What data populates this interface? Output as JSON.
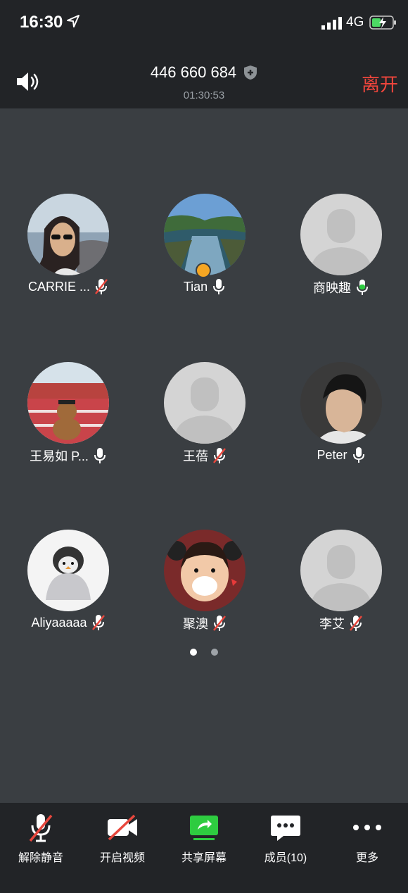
{
  "status_bar": {
    "time": "16:30",
    "network": "4G"
  },
  "header": {
    "meeting_id": "446 660 684",
    "timer": "01:30:53",
    "leave_label": "离开"
  },
  "participants": [
    {
      "name": "CARRIE ...",
      "mic": "muted",
      "avatar": "photo"
    },
    {
      "name": "Tian",
      "mic": "on",
      "avatar": "photo",
      "host": true
    },
    {
      "name": "商映趣",
      "mic": "speaking",
      "avatar": "placeholder"
    },
    {
      "name": "王易如 P...",
      "mic": "on",
      "avatar": "photo"
    },
    {
      "name": "王蓓",
      "mic": "muted",
      "avatar": "placeholder"
    },
    {
      "name": "Peter",
      "mic": "on",
      "avatar": "photo"
    },
    {
      "name": "Aliyaaaaa",
      "mic": "muted",
      "avatar": "photo"
    },
    {
      "name": "聚澳",
      "mic": "muted",
      "avatar": "photo"
    },
    {
      "name": "李艾",
      "mic": "muted",
      "avatar": "placeholder"
    }
  ],
  "pagination": {
    "current": 1,
    "total": 2
  },
  "toolbar": {
    "unmute_label": "解除静音",
    "video_label": "开启视频",
    "share_label": "共享屏幕",
    "members_label": "成员(10)",
    "more_label": "更多"
  },
  "colors": {
    "leave": "#f0463c",
    "speaking": "#2ecc40",
    "share": "#2ecc40",
    "muted_slash": "#e8473d"
  }
}
